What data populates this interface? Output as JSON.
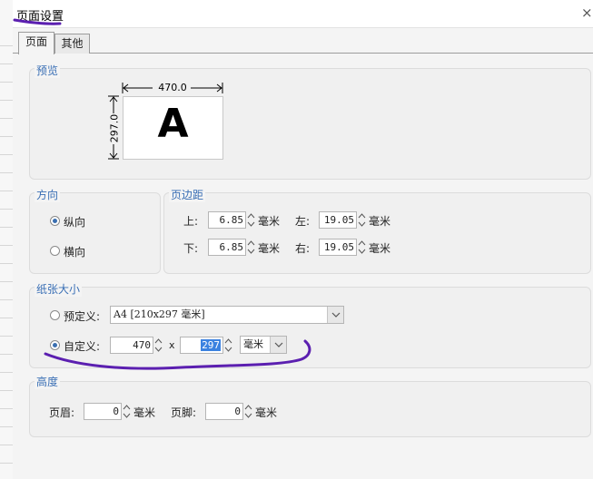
{
  "dialog": {
    "title": "页面设置"
  },
  "tabs": [
    {
      "label": "页面"
    },
    {
      "label": "其他"
    }
  ],
  "preview": {
    "label": "预览",
    "width_text": "470.0",
    "height_text": "297.0",
    "letter": "A"
  },
  "orientation": {
    "label": "方向",
    "portrait": "纵向",
    "landscape": "横向",
    "selected": "纵向"
  },
  "margins": {
    "label": "页边距",
    "top_label": "上:",
    "top_value": "6.85",
    "bottom_label": "下:",
    "bottom_value": "6.85",
    "left_label": "左:",
    "left_value": "19.05",
    "right_label": "右:",
    "right_value": "19.05",
    "unit": "毫米"
  },
  "paper": {
    "label": "纸张大小",
    "predefined_label": "预定义:",
    "predefined_value": "A4 [210x297 毫米]",
    "custom_label": "自定义:",
    "custom_width": "470",
    "times": "x",
    "custom_height": "297",
    "unit_select": "毫米",
    "selected": "自定义"
  },
  "height": {
    "label": "高度",
    "header_label": "页眉:",
    "header_value": "0",
    "footer_label": "页脚:",
    "footer_value": "0",
    "unit": "毫米"
  },
  "colors": {
    "accent_label": "#3a6fb5",
    "annotation": "#5b1fb0",
    "selection": "#3b82e0"
  }
}
